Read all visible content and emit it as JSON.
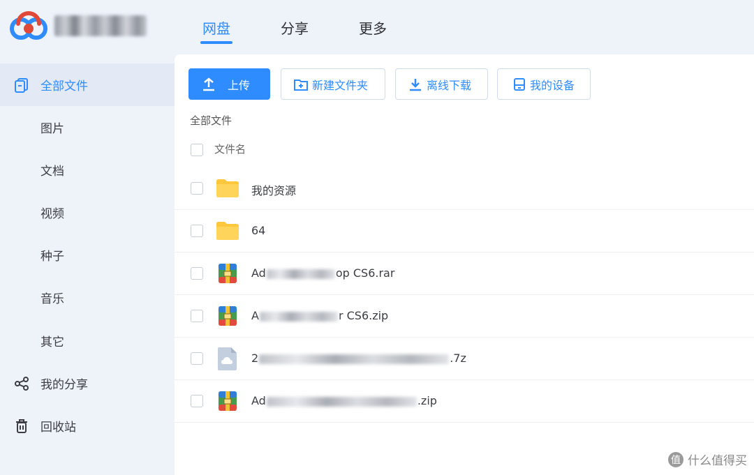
{
  "header": {
    "tabs": [
      {
        "label": "网盘",
        "active": true
      },
      {
        "label": "分享",
        "active": false
      },
      {
        "label": "更多",
        "active": false
      }
    ]
  },
  "sidebar": {
    "items": [
      {
        "label": "全部文件",
        "icon": "file-copy-icon",
        "active": true
      },
      {
        "label": "图片",
        "icon": "",
        "active": false
      },
      {
        "label": "文档",
        "icon": "",
        "active": false
      },
      {
        "label": "视频",
        "icon": "",
        "active": false
      },
      {
        "label": "种子",
        "icon": "",
        "active": false
      },
      {
        "label": "音乐",
        "icon": "",
        "active": false
      },
      {
        "label": "其它",
        "icon": "",
        "active": false
      },
      {
        "label": "我的分享",
        "icon": "share-icon",
        "active": false
      },
      {
        "label": "回收站",
        "icon": "trash-icon",
        "active": false
      }
    ]
  },
  "toolbar": {
    "upload_label": "上传",
    "new_folder_label": "新建文件夹",
    "offline_download_label": "离线下载",
    "my_devices_label": "我的设备"
  },
  "main": {
    "breadcrumb": "全部文件",
    "column_header": "文件名",
    "files": [
      {
        "name_visible": "我的资源",
        "type": "folder-icon"
      },
      {
        "name_visible": "64",
        "type": "folder-icon"
      },
      {
        "name_prefix": "Ad",
        "name_suffix": "op CS6.rar",
        "type": "archive-icon"
      },
      {
        "name_prefix": "A",
        "name_suffix": "r CS6.zip",
        "type": "archive-icon"
      },
      {
        "name_prefix": "2",
        "name_suffix": ".7z",
        "type": "generic-file-icon"
      },
      {
        "name_prefix": "Ad",
        "name_suffix": ".zip",
        "type": "archive-icon"
      }
    ]
  },
  "watermark": {
    "icon_text": "值",
    "text": "什么值得买"
  },
  "colors": {
    "accent": "#2f8cff",
    "sidebar_bg": "#eef3fa",
    "active_item_bg": "#e3eaf5",
    "folder": "#ffcb45"
  }
}
